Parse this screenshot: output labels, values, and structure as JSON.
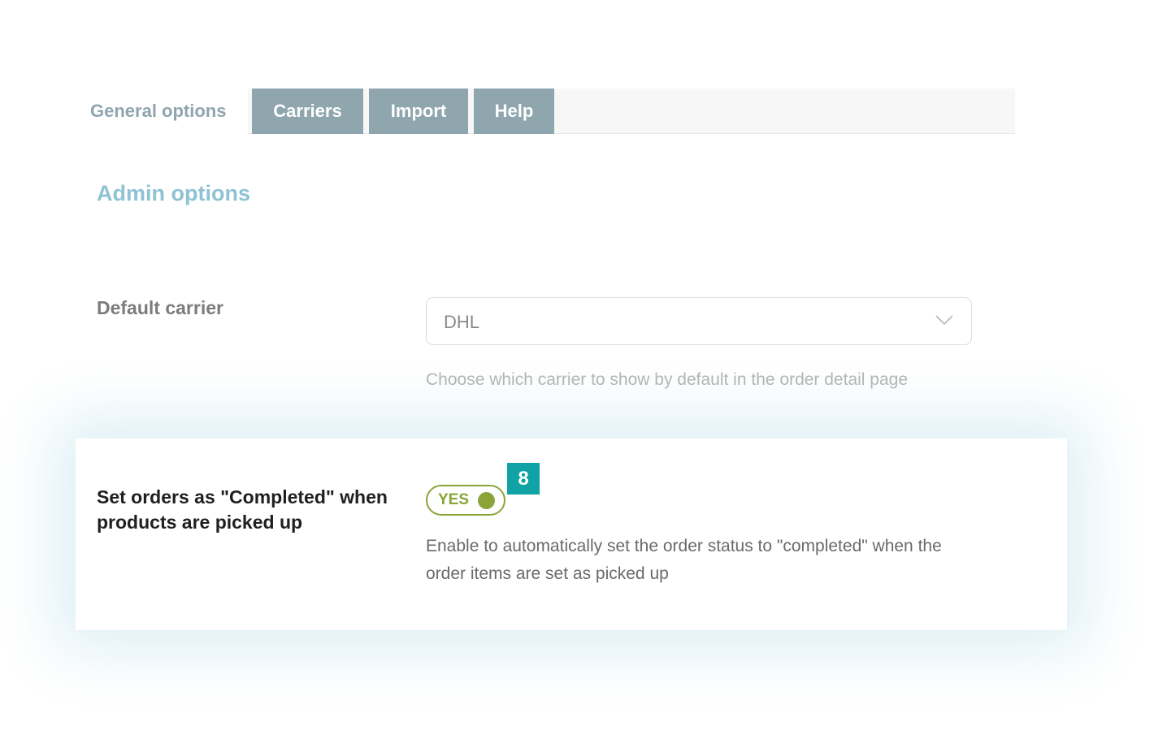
{
  "tabs": {
    "active_label": "General options",
    "items": [
      {
        "label": "Carriers"
      },
      {
        "label": "Import"
      },
      {
        "label": "Help"
      }
    ]
  },
  "section": {
    "title": "Admin options"
  },
  "default_carrier": {
    "label": "Default carrier",
    "value": "DHL",
    "help": "Choose which carrier to show by default in the order detail page"
  },
  "completed_option": {
    "label": "Set orders as \"Completed\" when products are picked up",
    "toggle_label": "YES",
    "enabled": true,
    "badge": "8",
    "description": "Enable to automatically set the order status to \"completed\" when the order items are set as picked up"
  },
  "colors": {
    "tab_bg": "#8fa6ae",
    "section_title": "#8ec2d4",
    "toggle_on": "#8aa437",
    "badge_bg": "#10a2a4"
  },
  "icons": {
    "select_arrow": "chevron-down-icon"
  }
}
